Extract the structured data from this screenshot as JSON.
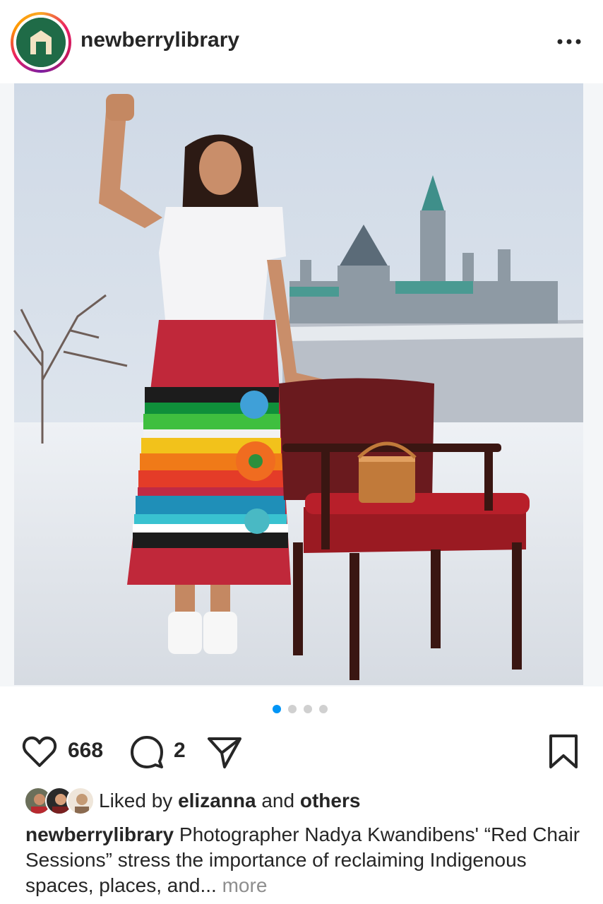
{
  "post": {
    "username": "newberrylibrary",
    "more_menu_icon": "more-horizontal-icon"
  },
  "media": {
    "description_icon": "post-photo",
    "carousel_count": 4,
    "carousel_active_index": 0
  },
  "actions": {
    "like_icon": "heart-icon",
    "like_count": "668",
    "comment_icon": "comment-icon",
    "comment_count": "2",
    "share_icon": "send-icon",
    "save_icon": "bookmark-icon"
  },
  "liked_by": {
    "prefix": "Liked by ",
    "user": "elizanna",
    "conjunction": " and ",
    "others": "others"
  },
  "caption": {
    "username": "newberrylibrary",
    "text": " Photographer Nadya Kwandibens' “Red Chair Sessions” stress the importance of reclaiming Indigenous spaces, places, and...",
    "more_label": " more"
  },
  "colors": {
    "accent_blue": "#0095f6",
    "text": "#262626",
    "muted": "#8e8e8e",
    "brand_green": "#1f6b47"
  }
}
